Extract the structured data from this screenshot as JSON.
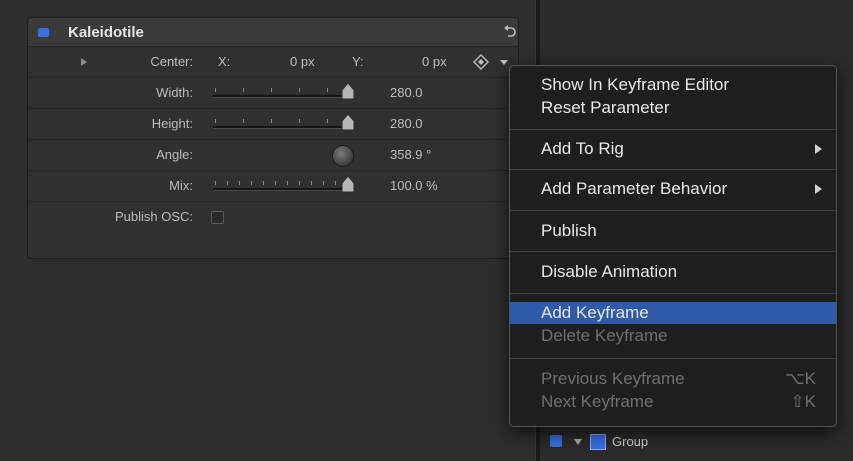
{
  "panel": {
    "title": "Kaleidotile",
    "rows": {
      "center": {
        "label": "Center:",
        "x_label": "X:",
        "x_value": "0 px",
        "y_label": "Y:",
        "y_value": "0 px"
      },
      "width": {
        "label": "Width:",
        "value": "280.0"
      },
      "height": {
        "label": "Height:",
        "value": "280.0"
      },
      "angle": {
        "label": "Angle:",
        "value": "358.9 °"
      },
      "mix": {
        "label": "Mix:",
        "value": "100.0 %"
      },
      "publish_osc": {
        "label": "Publish OSC:",
        "checked": false
      }
    },
    "accent_color": "#3b6fe0"
  },
  "layers": {
    "group_label": "Group",
    "group_checked": true
  },
  "context_menu": {
    "items": [
      {
        "label": "Show In Keyframe Editor",
        "enabled": true
      },
      {
        "label": "Reset Parameter",
        "enabled": true
      },
      {
        "label": "Add To Rig",
        "enabled": true,
        "submenu": true
      },
      {
        "label": "Add Parameter Behavior",
        "enabled": true,
        "submenu": true
      },
      {
        "label": "Publish",
        "enabled": true
      },
      {
        "label": "Disable Animation",
        "enabled": true
      },
      {
        "label": "Add Keyframe",
        "enabled": true,
        "selected": true
      },
      {
        "label": "Delete Keyframe",
        "enabled": false
      },
      {
        "label": "Previous Keyframe",
        "enabled": false,
        "shortcut": "⌥K"
      },
      {
        "label": "Next Keyframe",
        "enabled": false,
        "shortcut": "⇧K"
      }
    ],
    "selected_color": "#2f5aa8"
  }
}
